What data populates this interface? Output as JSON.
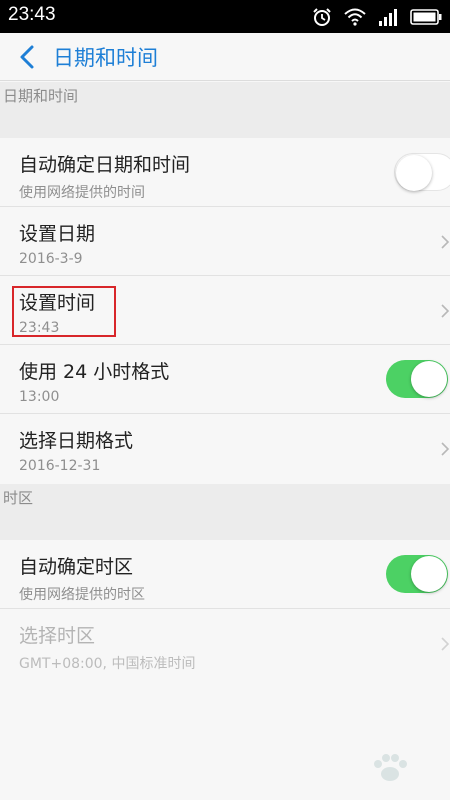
{
  "status_bar": {
    "time": "23:43",
    "icons": [
      "alarm-icon",
      "wifi-icon",
      "signal-icon",
      "battery-icon"
    ]
  },
  "header": {
    "back_icon": "chevron-left-icon",
    "title": "日期和时间"
  },
  "sections": {
    "date_time": {
      "label": "日期和时间"
    },
    "timezone": {
      "label": "时区"
    }
  },
  "rows": {
    "auto_datetime": {
      "title": "自动确定日期和时间",
      "subtitle": "使用网络提供的时间",
      "toggle_on": false
    },
    "set_date": {
      "title": "设置日期",
      "subtitle": "2016-3-9"
    },
    "set_time": {
      "title": "设置时间",
      "subtitle": "23:43"
    },
    "use_24h": {
      "title": "使用 24 小时格式",
      "subtitle": "13:00",
      "toggle_on": true
    },
    "date_format": {
      "title": "选择日期格式",
      "subtitle": "2016-12-31"
    },
    "auto_timezone": {
      "title": "自动确定时区",
      "subtitle": "使用网络提供的时区",
      "toggle_on": true
    },
    "select_timezone": {
      "title": "选择时区",
      "subtitle": "GMT+08:00, 中国标准时间",
      "disabled": true
    }
  },
  "colors": {
    "accent": "#1e7fd6",
    "toggle_on": "#4cd164",
    "highlight_box": "#d8262a"
  }
}
